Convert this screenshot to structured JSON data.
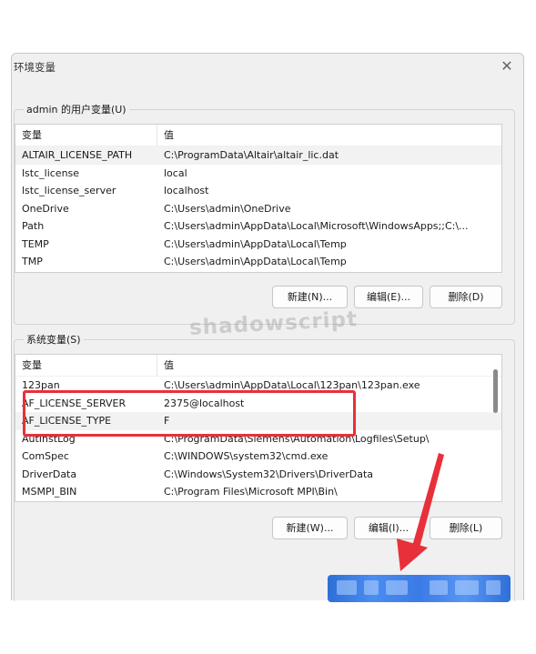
{
  "dialog": {
    "title": "环境变量",
    "close_glyph": "✕"
  },
  "user_vars": {
    "legend": "admin 的用户变量(U)",
    "headers": [
      "变量",
      "值"
    ],
    "rows": [
      {
        "name": "ALTAIR_LICENSE_PATH",
        "value": "C:\\ProgramData\\Altair\\altair_lic.dat"
      },
      {
        "name": "lstc_license",
        "value": "local"
      },
      {
        "name": "lstc_license_server",
        "value": "localhost"
      },
      {
        "name": "OneDrive",
        "value": "C:\\Users\\admin\\OneDrive"
      },
      {
        "name": "Path",
        "value": "C:\\Users\\admin\\AppData\\Local\\Microsoft\\WindowsApps;;C:\\..."
      },
      {
        "name": "TEMP",
        "value": "C:\\Users\\admin\\AppData\\Local\\Temp"
      },
      {
        "name": "TMP",
        "value": "C:\\Users\\admin\\AppData\\Local\\Temp"
      }
    ],
    "buttons": {
      "new": "新建(N)...",
      "edit": "编辑(E)...",
      "delete": "删除(D)"
    }
  },
  "system_vars": {
    "legend": "系统变量(S)",
    "headers": [
      "变量",
      "值"
    ],
    "rows": [
      {
        "name": "123pan",
        "value": "C:\\Users\\admin\\AppData\\Local\\123pan\\123pan.exe"
      },
      {
        "name": "AF_LICENSE_SERVER",
        "value": "2375@localhost"
      },
      {
        "name": "AF_LICENSE_TYPE",
        "value": "F"
      },
      {
        "name": "AutInstLog",
        "value": "C:\\ProgramData\\Siemens\\Automation\\Logfiles\\Setup\\"
      },
      {
        "name": "ComSpec",
        "value": "C:\\WINDOWS\\system32\\cmd.exe"
      },
      {
        "name": "DriverData",
        "value": "C:\\Windows\\System32\\Drivers\\DriverData"
      },
      {
        "name": "MSMPI_BIN",
        "value": "C:\\Program Files\\Microsoft MPI\\Bin\\"
      }
    ],
    "buttons": {
      "new": "新建(W)...",
      "edit": "编辑(I)...",
      "delete": "删除(L)"
    }
  },
  "watermark": "shadowscript",
  "colors": {
    "highlight": "#e8303a",
    "arrow": "#e8303a",
    "confirm_bar": "#3b7be6"
  }
}
